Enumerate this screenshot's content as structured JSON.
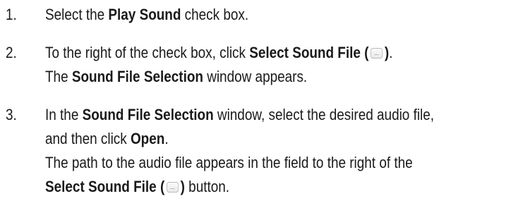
{
  "steps": [
    {
      "number": "1.",
      "lines": [
        {
          "t1": "Select the ",
          "b1": "Play Sound",
          "t2": " check box."
        }
      ]
    },
    {
      "number": "2.",
      "lines": [
        {
          "t1": "To the right of the check box, click ",
          "b1": "Select Sound File (",
          "b2": ")",
          "t2": "."
        },
        {
          "t1": "The ",
          "b1": "Sound File Selection",
          "t2": " window appears."
        }
      ]
    },
    {
      "number": "3.",
      "lines": [
        {
          "t1": "In the ",
          "b1": "Sound File Selection",
          "t2": " window, select the desired audio file,"
        },
        {
          "t1": "and then click ",
          "b1": "Open",
          "t2": "."
        },
        {
          "t1": "The path to the audio file appears in the field to the right of the"
        },
        {
          "b1": "Select Sound File (",
          "b2": ")",
          "t2": " button."
        }
      ]
    }
  ],
  "icons": {
    "ellipsis_glyph": "...",
    "ellipsis_icon_name": "ellipsis-button-icon"
  }
}
